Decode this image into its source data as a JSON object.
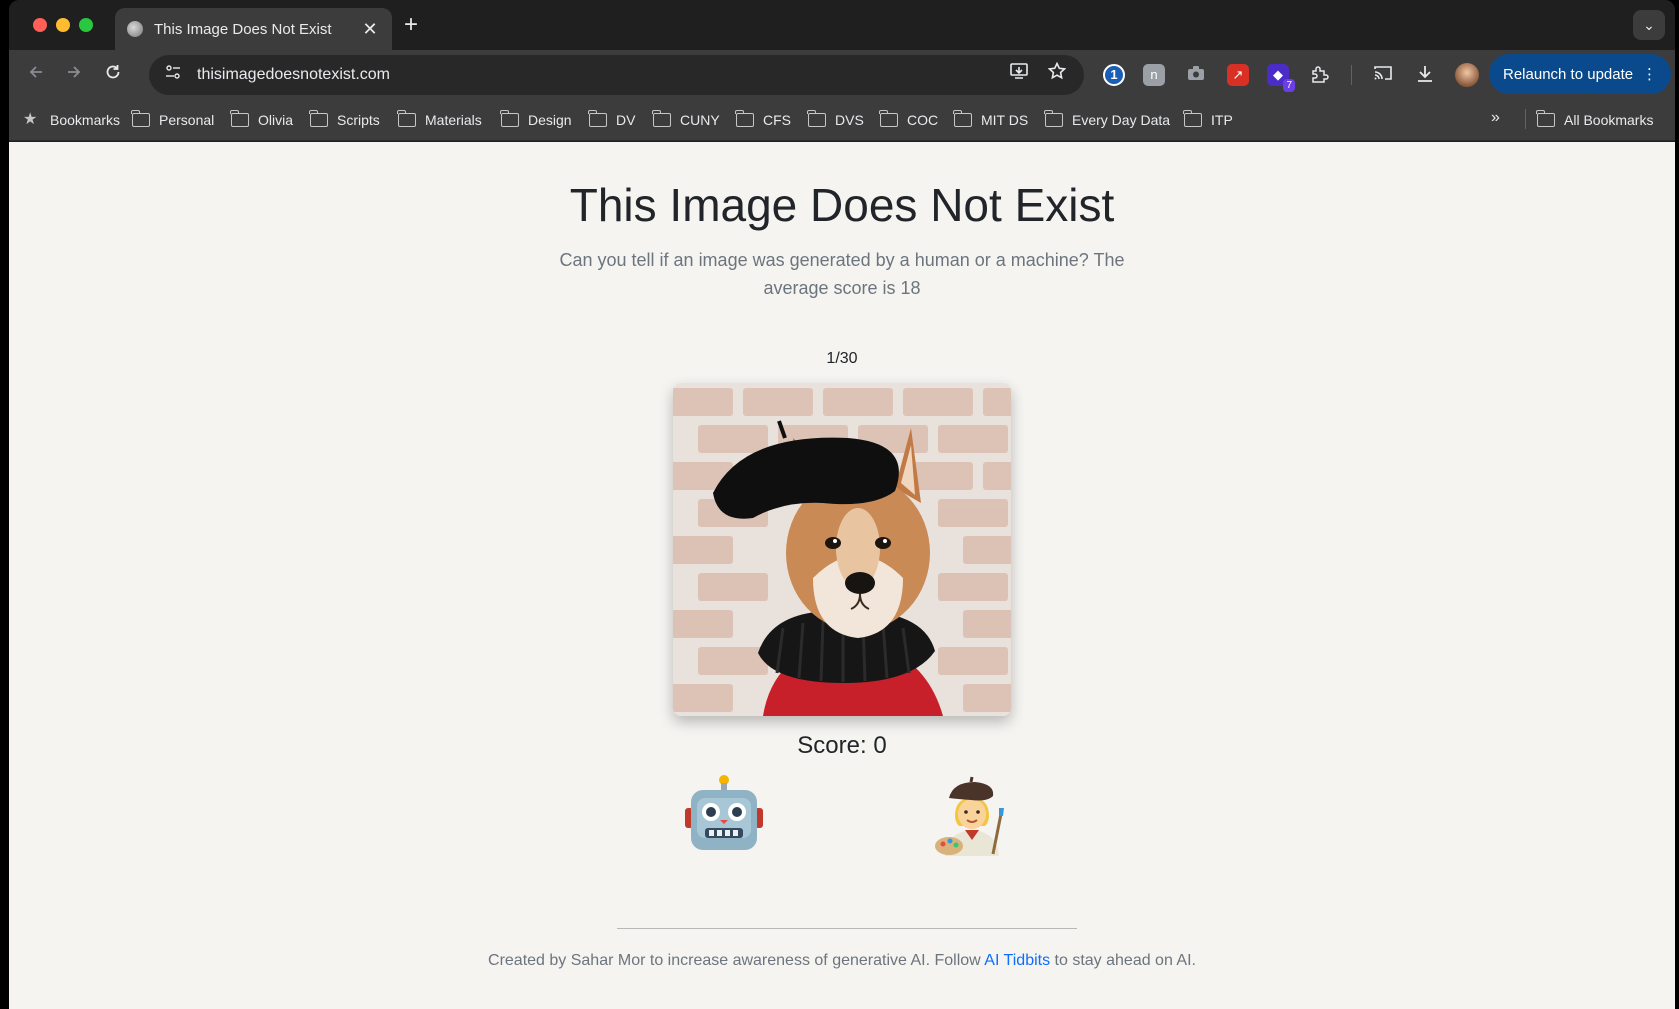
{
  "browser": {
    "tab_title": "This Image Does Not Exist",
    "tab_close": "✕",
    "new_tab": "+",
    "tab_search": "⌄",
    "url": "thisimagedoesnotexist.com",
    "relaunch_label": "Relaunch to update",
    "relaunch_menu": "⋮",
    "extension_badge": "7"
  },
  "bookmarks": {
    "items": [
      {
        "label": "Bookmarks",
        "icon": "star-icon"
      },
      {
        "label": "Personal",
        "icon": "folder-icon"
      },
      {
        "label": "Olivia",
        "icon": "folder-icon"
      },
      {
        "label": "Scripts",
        "icon": "folder-icon"
      },
      {
        "label": "Materials",
        "icon": "folder-icon"
      },
      {
        "label": "Design",
        "icon": "folder-icon"
      },
      {
        "label": "DV",
        "icon": "folder-icon"
      },
      {
        "label": "CUNY",
        "icon": "folder-icon"
      },
      {
        "label": "CFS",
        "icon": "folder-icon"
      },
      {
        "label": "DVS",
        "icon": "folder-icon"
      },
      {
        "label": "COC",
        "icon": "folder-icon"
      },
      {
        "label": "MIT DS",
        "icon": "folder-icon"
      },
      {
        "label": "Every Day Data",
        "icon": "folder-icon"
      },
      {
        "label": "ITP",
        "icon": "folder-icon"
      }
    ],
    "more": "»",
    "all_bookmarks": "All Bookmarks"
  },
  "page": {
    "title": "This Image Does Not Exist",
    "subtitle": "Can you tell if an image was generated by a human or a machine? The average score is 18",
    "counter": "1/30",
    "score": "Score: 0",
    "choices": {
      "machine_icon": "robot-icon",
      "human_icon": "artist-icon"
    },
    "footer": {
      "before": "Created by Sahar Mor to increase awareness of generative AI. Follow ",
      "link": "AI Tidbits",
      "after": " to stay ahead on AI."
    }
  },
  "colors": {
    "page_bg": "#f5f4f1",
    "chrome_bg": "#3c3c3c",
    "link": "#0d6efd",
    "relaunch": "#0a4a8c"
  }
}
